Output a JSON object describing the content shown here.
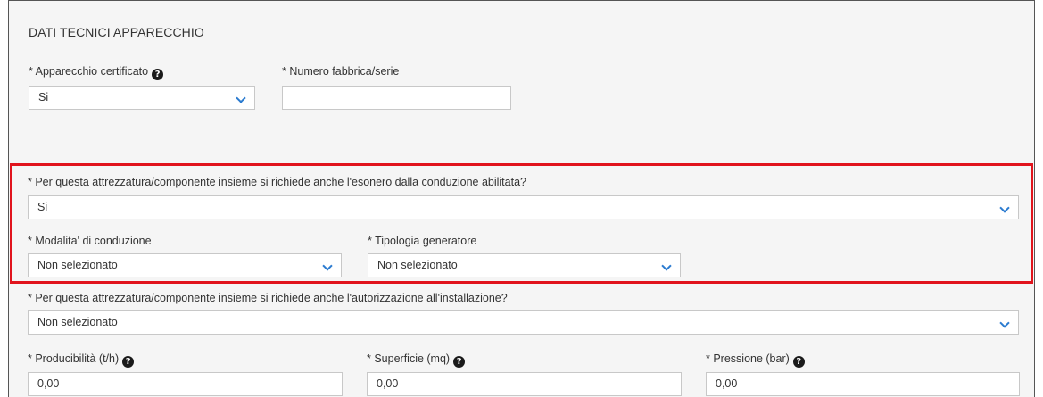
{
  "section": {
    "title": "DATI TECNICI APPARECCHIO"
  },
  "apparecchio_certificato": {
    "label": "* Apparecchio certificato",
    "value": "Si"
  },
  "numero_fabbrica": {
    "label": "* Numero fabbrica/serie",
    "value": ""
  },
  "esonero": {
    "label": "* Per questa attrezzatura/componente insieme si richiede anche l'esonero dalla conduzione abilitata?",
    "value": "Si"
  },
  "modalita_conduzione": {
    "label": "* Modalita' di conduzione",
    "value": "Non selezionato"
  },
  "tipologia_generatore": {
    "label": "* Tipologia generatore",
    "value": "Non selezionato"
  },
  "autorizzazione": {
    "label": "* Per questa attrezzatura/componente insieme si richiede anche l'autorizzazione all'installazione?",
    "value": "Non selezionato"
  },
  "producibilita": {
    "label": "* Producibilità (t/h)",
    "value": "0,00"
  },
  "superficie": {
    "label": "* Superficie (mq)",
    "value": "0,00"
  },
  "pressione": {
    "label": "* Pressione (bar)",
    "value": "0,00"
  },
  "icons": {
    "help": "question-circle-icon",
    "dropdown": "chevron-down-icon"
  },
  "colors": {
    "highlight": "#e1141d",
    "chevron": "#2b7bd0"
  }
}
